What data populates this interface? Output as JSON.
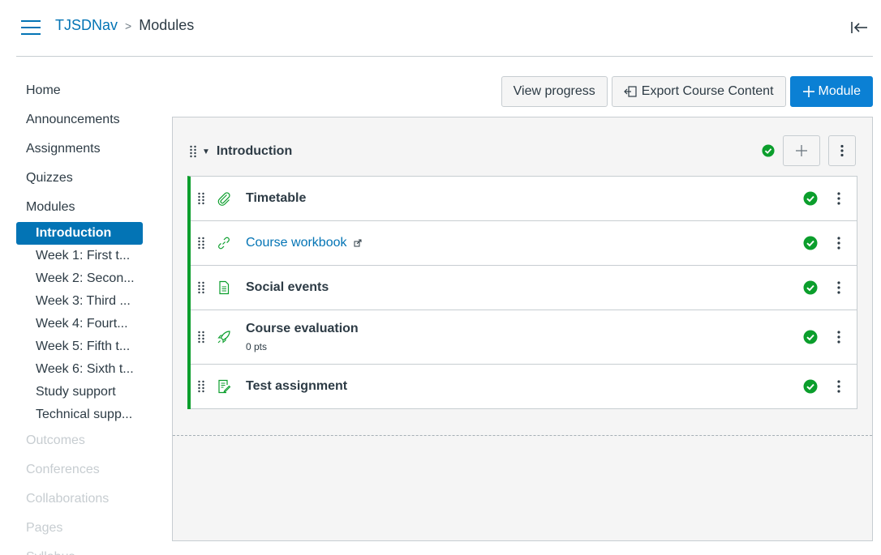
{
  "header": {
    "course": "TJSDNav",
    "separator": ">",
    "page": "Modules"
  },
  "sidebar": {
    "items_top": [
      {
        "label": "Home"
      },
      {
        "label": "Announcements"
      },
      {
        "label": "Assignments"
      },
      {
        "label": "Quizzes"
      },
      {
        "label": "Modules"
      }
    ],
    "module_links": [
      {
        "label": "Introduction",
        "active": true
      },
      {
        "label": "Week 1: First t..."
      },
      {
        "label": "Week 2: Secon..."
      },
      {
        "label": "Week 3: Third ..."
      },
      {
        "label": "Week 4: Fourt..."
      },
      {
        "label": "Week 5: Fifth t..."
      },
      {
        "label": "Week 6: Sixth t..."
      },
      {
        "label": "Study support"
      },
      {
        "label": "Technical supp..."
      }
    ],
    "items_disabled": [
      {
        "label": "Outcomes"
      },
      {
        "label": "Conferences"
      },
      {
        "label": "Collaborations"
      },
      {
        "label": "Pages"
      },
      {
        "label": "Syllabus"
      }
    ]
  },
  "toolbar": {
    "view_progress": "View progress",
    "export": "Export Course Content",
    "add_module": "Module"
  },
  "module": {
    "title": "Introduction",
    "items": [
      {
        "title": "Timetable",
        "type": "paperclip-icon",
        "link": false
      },
      {
        "title": "Course workbook",
        "type": "link-icon",
        "link": true
      },
      {
        "title": "Social events",
        "type": "page-icon",
        "link": false
      },
      {
        "title": "Course evaluation",
        "type": "quiz-rocket-icon",
        "link": false,
        "sub": "0 pts"
      },
      {
        "title": "Test assignment",
        "type": "assignment-icon",
        "link": false
      }
    ]
  },
  "colors": {
    "link": "#0374b5",
    "primary": "#0b80d4",
    "complete": "#0b9e2c",
    "text": "#2d3b45"
  }
}
